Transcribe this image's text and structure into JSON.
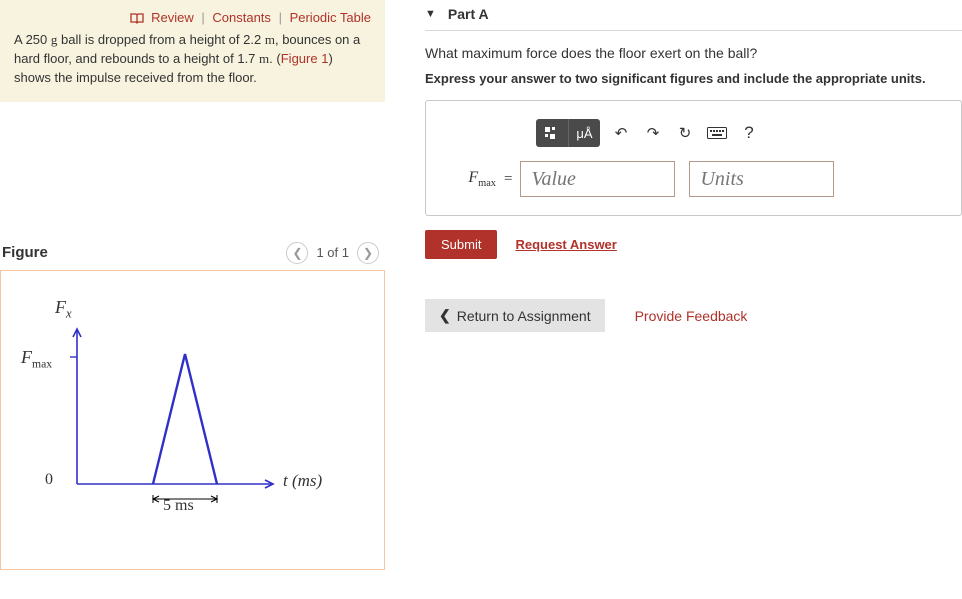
{
  "topLinks": {
    "review": "Review",
    "constants": "Constants",
    "periodic": "Periodic Table"
  },
  "problem": {
    "massVal": "250",
    "massUnit": "g",
    "preHeight": " ball is dropped from a height of ",
    "heightVal": "2.2",
    "heightUnit": "m",
    "afterHeight": ", bounces on a hard floor, and rebounds to a height of ",
    "reboundVal": "1.7",
    "reboundUnit": "m",
    "afterRebound": ". (",
    "figureRef": "Figure 1",
    "tail": ") shows the impulse received from the floor."
  },
  "figure": {
    "title": "Figure",
    "navText": "1 of 1",
    "yAxisLabel": "F",
    "yAxisSub": "x",
    "fmaxLabel": "F",
    "fmaxSub": "max",
    "origin": "0",
    "xLabel": "t (ms)",
    "tickLabel": "5 ms"
  },
  "partA": {
    "title": "Part A",
    "question": "What maximum force does the floor exert on the ball?",
    "instruction": "Express your answer to two significant figures and include the appropriate units.",
    "toolbar": {
      "special": "μÅ",
      "help": "?"
    },
    "varLabel": "F",
    "varSub": "max",
    "eq": "=",
    "valuePlaceholder": "Value",
    "unitsPlaceholder": "Units",
    "submit": "Submit",
    "request": "Request Answer"
  },
  "bottom": {
    "return": "Return to Assignment",
    "feedback": "Provide Feedback"
  },
  "chart_data": {
    "type": "line",
    "title": "Impulse received from floor",
    "xlabel": "t (ms)",
    "ylabel": "F_x",
    "x": [
      0,
      2.5,
      5
    ],
    "y": [
      0,
      "F_max",
      0
    ],
    "xlim": [
      0,
      8
    ],
    "ylim": [
      0,
      "F_max"
    ],
    "annotations": [
      "Triangular pulse of width 5 ms peaking at F_max"
    ]
  }
}
